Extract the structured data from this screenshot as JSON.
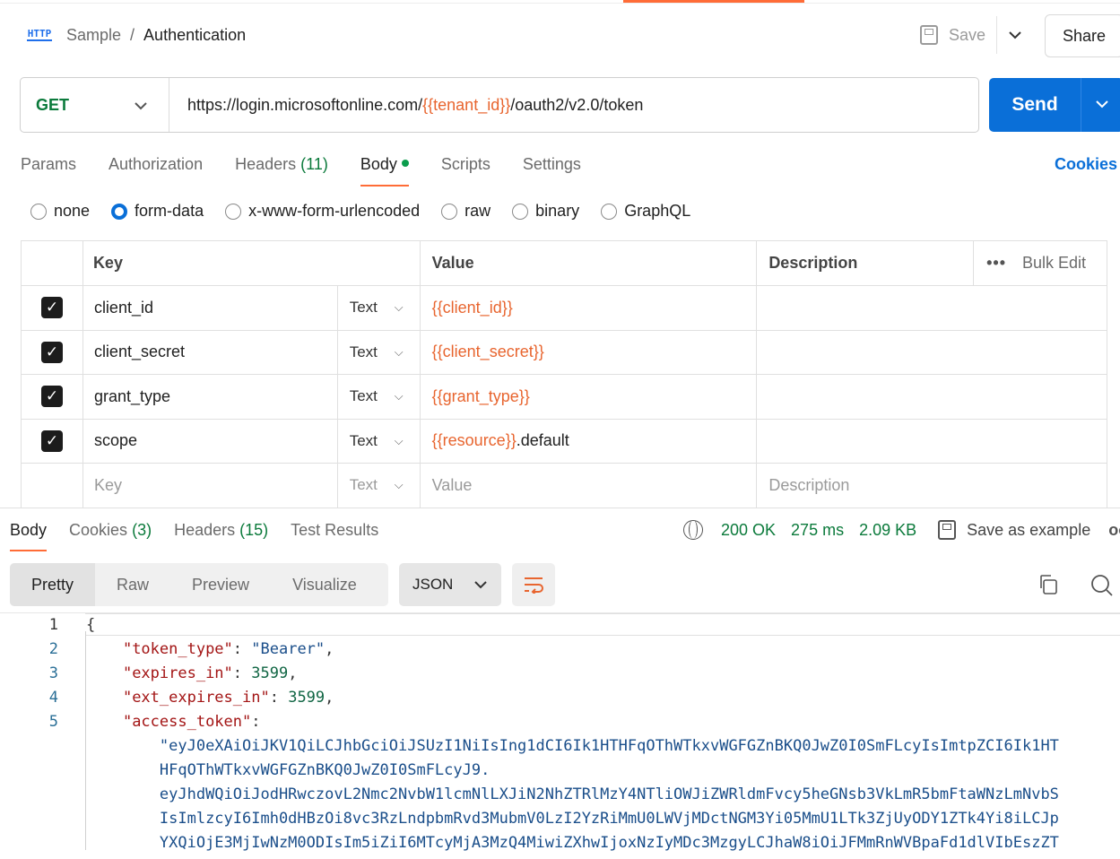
{
  "header": {
    "icon_label": "HTTP",
    "breadcrumb_parent": "Sample",
    "breadcrumb_sep": "/",
    "title": "Authentication",
    "save_label": "Save",
    "share_label": "Share"
  },
  "request": {
    "method": "GET",
    "url_prefix": "https://login.microsoftonline.com/",
    "url_var": "{{tenant_id}}",
    "url_suffix": "/oauth2/v2.0/token",
    "send_label": "Send"
  },
  "req_tabs": {
    "params": "Params",
    "authorization": "Authorization",
    "headers": "Headers",
    "headers_count": "(11)",
    "body": "Body",
    "scripts": "Scripts",
    "settings": "Settings",
    "cookies": "Cookies"
  },
  "body_types": [
    "none",
    "form-data",
    "x-www-form-urlencoded",
    "raw",
    "binary",
    "GraphQL"
  ],
  "table": {
    "col_key": "Key",
    "col_value": "Value",
    "col_description": "Description",
    "bulk_edit": "Bulk Edit",
    "more": "•••",
    "rows": [
      {
        "key": "client_id",
        "type": "Text",
        "value_var": "{{client_id}}",
        "value_suffix": ""
      },
      {
        "key": "client_secret",
        "type": "Text",
        "value_var": "{{client_secret}}",
        "value_suffix": ""
      },
      {
        "key": "grant_type",
        "type": "Text",
        "value_var": "{{grant_type}}",
        "value_suffix": ""
      },
      {
        "key": "scope",
        "type": "Text",
        "value_var": "{{resource}}",
        "value_suffix": ".default"
      }
    ],
    "empty_row": {
      "key": "Key",
      "type": "Text",
      "value": "Value",
      "description": "Description"
    }
  },
  "response": {
    "tabs": {
      "body": "Body",
      "cookies": "Cookies",
      "cookies_count": "(3)",
      "headers": "Headers",
      "headers_count": "(15)",
      "test_results": "Test Results"
    },
    "status": "200 OK",
    "time": "275 ms",
    "size": "2.09 KB",
    "save_example": "Save as example",
    "more": "oo",
    "views": [
      "Pretty",
      "Raw",
      "Preview",
      "Visualize"
    ],
    "format": "JSON"
  },
  "code": {
    "line_numbers": [
      "1",
      "2",
      "3",
      "4",
      "5"
    ],
    "open_brace": "{",
    "token_type_key": "\"token_type\"",
    "token_type_val": "\"Bearer\"",
    "expires_in_key": "\"expires_in\"",
    "expires_in_val": "3599",
    "ext_expires_in_key": "\"ext_expires_in\"",
    "ext_expires_in_val": "3599",
    "access_token_key": "\"access_token\"",
    "access_token_lines": [
      "\"eyJ0eXAiOiJKV1QiLCJhbGciOiJSUzI1NiIsIng1dCI6Ik1HTHFqOThWTkxvWGFGZnBKQ0JwZ0I0SmFLcyIsImtpZCI6Ik1HT",
      "HFqOThWTkxvWGFGZnBKQ0JwZ0I0SmFLcyJ9.",
      "eyJhdWQiOiJodHRwczovL2Nmc2NvbW1lcmNlLXJiN2NhZTRlMzY4NTliOWJiZWRldmFvcy5heGNsb3VkLmR5bmFtaWNzLmNvbS",
      "IsImlzcyI6Imh0dHBzOi8vc3RzLndpbmRvd3MubmV0LzI2YzRiMmU0LWVjMDctNGM3Yi05MmU1LTk3ZjUyODY1ZTk4Yi8iLCJp",
      "YXQiOjE3MjIwNzM0ODIsIm5iZiI6MTcyMjA3MzQ4MiwiZXhwIjoxNzIyMDc3MzgyLCJhaW8iOiJFMmRnWVBpaFd1dlVIbEszZT"
    ]
  }
}
